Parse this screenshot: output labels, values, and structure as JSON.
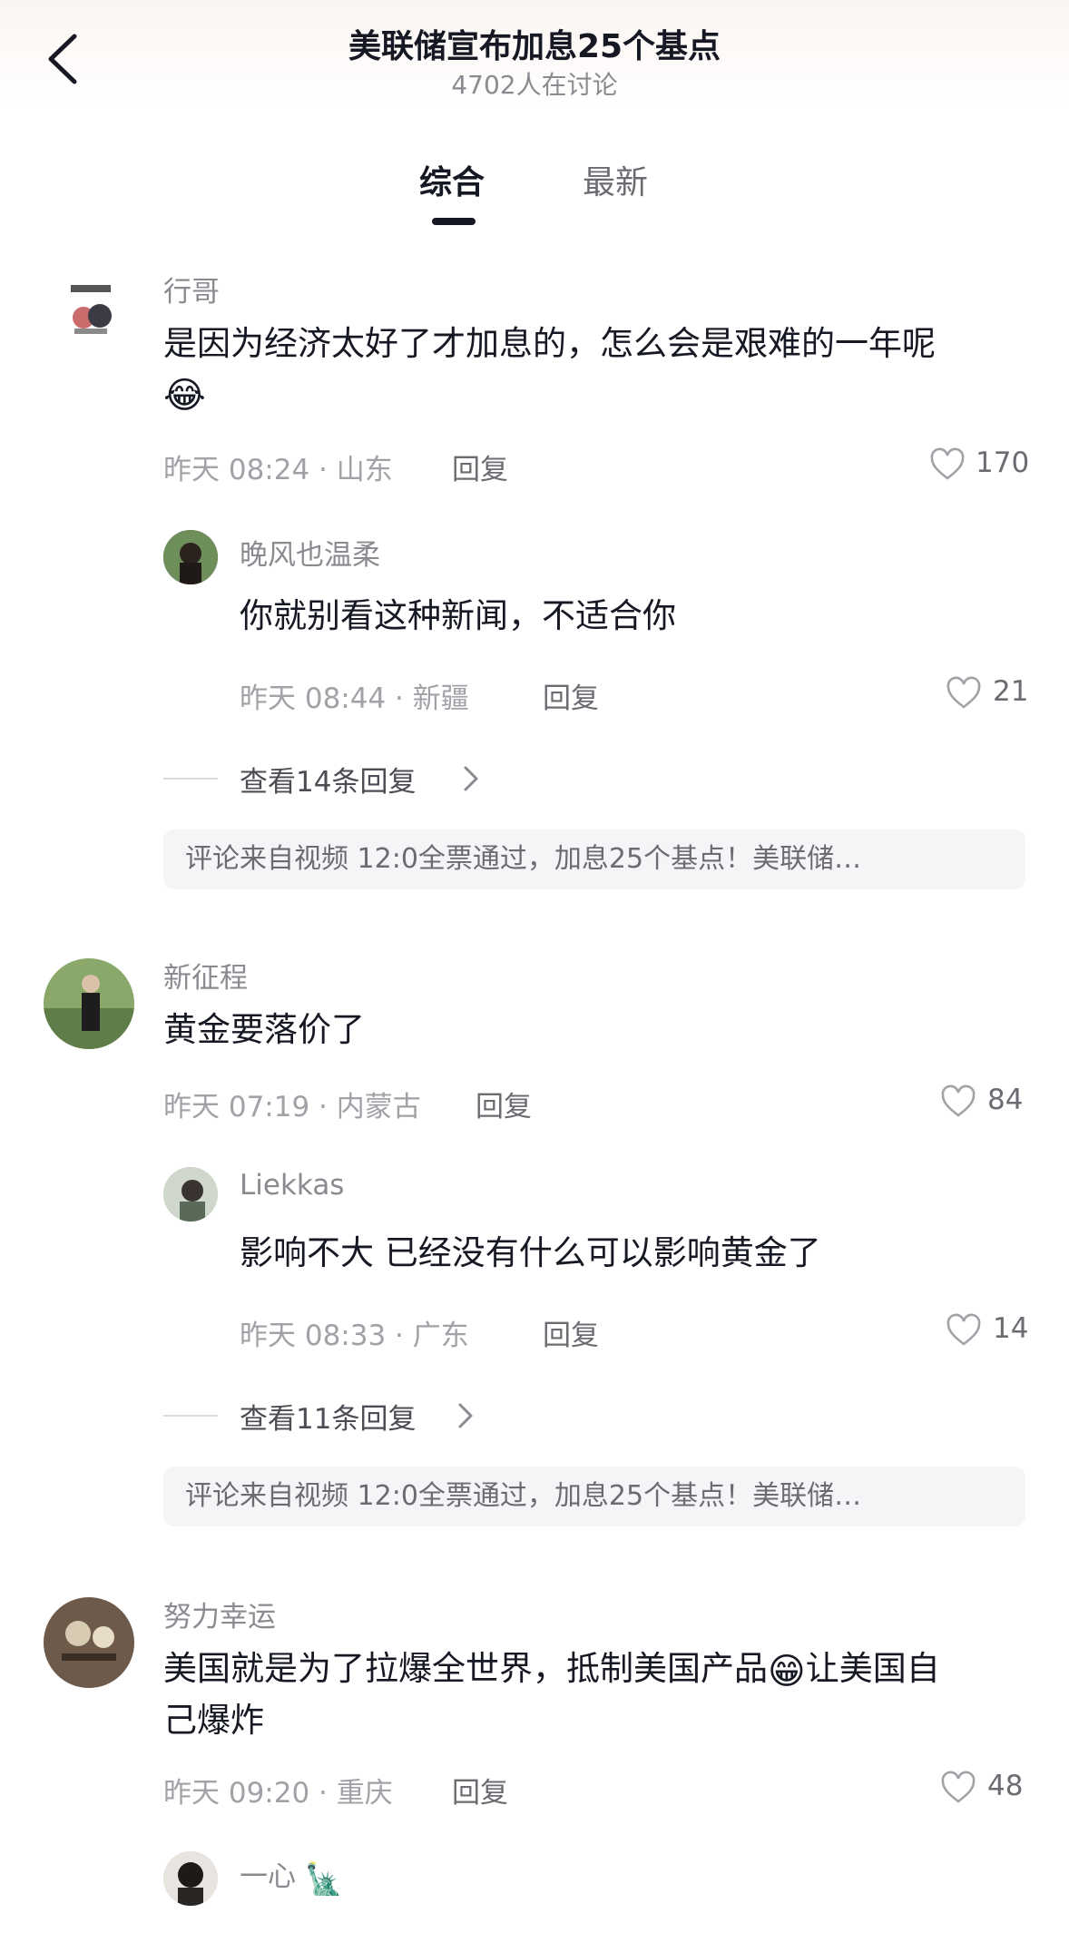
{
  "header": {
    "title": "美联储宣布加息25个基点",
    "subtitle": "4702人在讨论"
  },
  "tabs": [
    {
      "label": "综合",
      "active": true
    },
    {
      "label": "最新",
      "active": false
    }
  ],
  "comments": [
    {
      "user": "行哥",
      "text": "是因为经济太好了才加息的，怎么会是艰难的一年呢",
      "emoji": "😂",
      "meta": "昨天 08:24 · 山东",
      "reply_label": "回复",
      "likes": "170",
      "replies": [
        {
          "user": "晚风也温柔",
          "text": "你就别看这种新闻，不适合你",
          "meta": "昨天 08:44 · 新疆",
          "reply_label": "回复",
          "likes": "21"
        }
      ],
      "more_replies": "查看14条回复",
      "source": "评论来自视频  12:0全票通过，加息25个基点！美联储…"
    },
    {
      "user": "新征程",
      "text": "黄金要落价了",
      "meta": "昨天 07:19 · 内蒙古",
      "reply_label": "回复",
      "likes": "84",
      "replies": [
        {
          "user": "Liekkas",
          "text": "影响不大  已经没有什么可以影响黄金了",
          "meta": "昨天 08:33 · 广东",
          "reply_label": "回复",
          "likes": "14"
        }
      ],
      "more_replies": "查看11条回复",
      "source": "评论来自视频  12:0全票通过，加息25个基点！美联储…"
    },
    {
      "user": "努力幸运",
      "text_part1": "美国就是为了拉爆全世界，抵制美国产品",
      "emoji": "😁",
      "text_part2": "让美国自",
      "text_line2": "己爆炸",
      "meta": "昨天 09:20 · 重庆",
      "reply_label": "回复",
      "likes": "48",
      "replies": [
        {
          "user": "一心",
          "emoji": "🗽"
        }
      ]
    }
  ],
  "icons": {
    "back": "chevron-left-icon",
    "like": "heart-outline-icon",
    "more": "chevron-right-icon"
  },
  "colors": {
    "text_primary": "#161823",
    "text_secondary": "#8a8b91",
    "source_bg": "#f5f5f7"
  }
}
